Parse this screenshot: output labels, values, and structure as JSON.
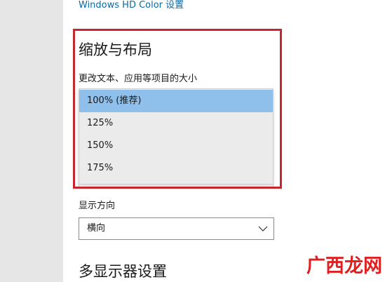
{
  "header": {
    "hd_color_link": "Windows HD Color 设置"
  },
  "scale_layout": {
    "title": "缩放与布局",
    "text_size_label": "更改文本、应用等项目的大小",
    "options": [
      "100% (推荐)",
      "125%",
      "150%",
      "175%"
    ],
    "selected_index": 0
  },
  "orientation": {
    "label": "显示方向",
    "value": "横向",
    "chevron_icon": "chevron-down-icon"
  },
  "multi_display": {
    "title": "多显示器设置"
  },
  "watermark": {
    "text": "广西龙网"
  },
  "colors": {
    "highlight": "#c6262e",
    "selected_option": "#8fc0ec",
    "link": "#0a6aa1",
    "left_pane": "#e6e6e6",
    "watermark_red": "#e02020"
  }
}
